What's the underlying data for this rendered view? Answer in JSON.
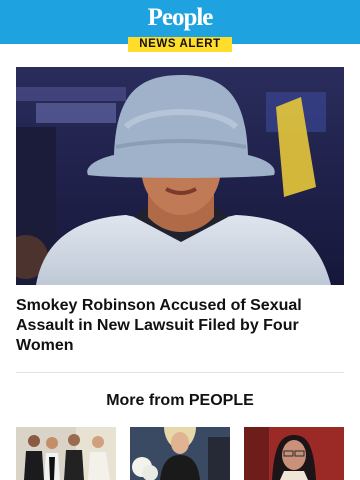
{
  "header": {
    "logo_text": "People",
    "badge": "NEWS ALERT",
    "brand_color": "#1fa3e0",
    "badge_color": "#ffdd2a"
  },
  "article": {
    "image_icon": "photo-icon",
    "headline": "Smokey Robinson Accused of Sexual Assault in New Lawsuit Filed by Four Women"
  },
  "more": {
    "title": "More from PEOPLE"
  }
}
